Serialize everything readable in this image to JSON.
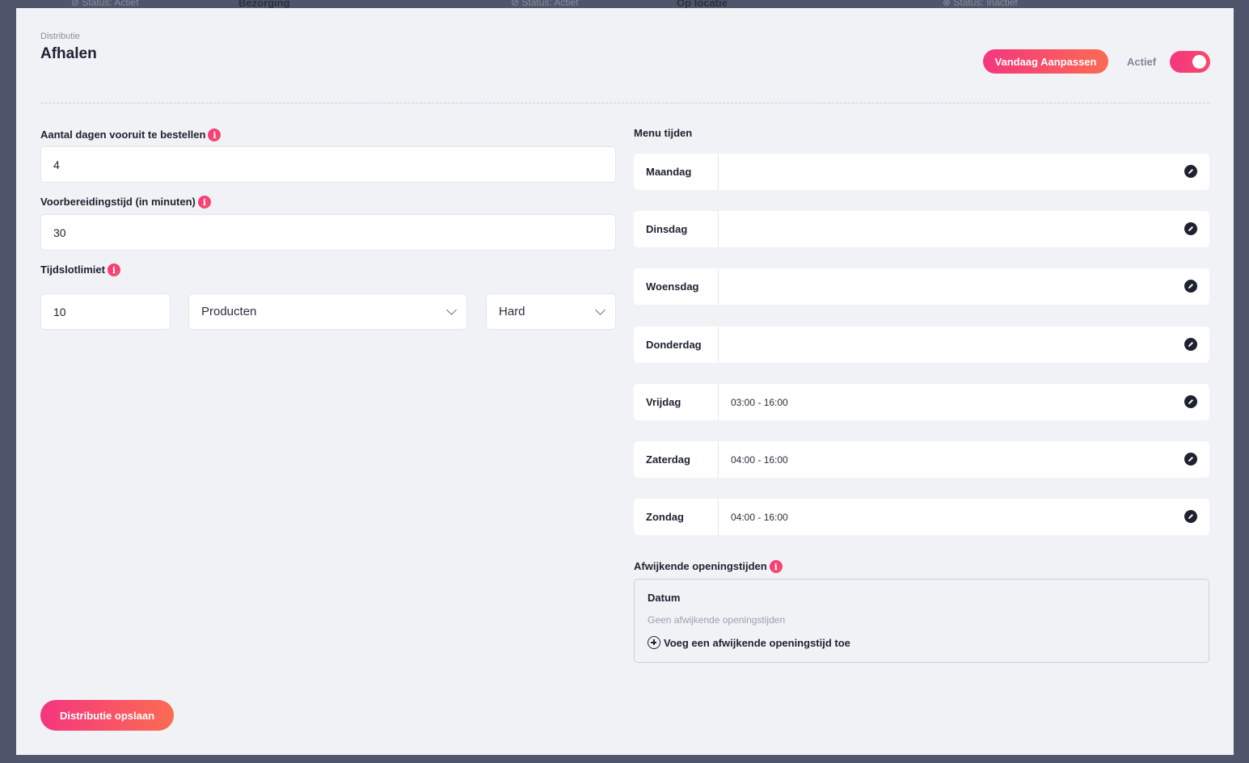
{
  "background_strip": {
    "items": [
      {
        "text": "⊘ Status: Actief"
      },
      {
        "text": "Bezorging",
        "bold": true
      },
      {
        "text": "⊘ Status: Actief"
      },
      {
        "text": "Op locatie",
        "bold": true
      },
      {
        "text": "⊗ Status: Inactief"
      }
    ]
  },
  "header": {
    "breadcrumb": "Distributie",
    "title": "Afhalen",
    "today_button": "Vandaag Aanpassen",
    "active_label": "Actief",
    "active_toggle": true
  },
  "form": {
    "days_ahead": {
      "label": "Aantal dagen vooruit te bestellen",
      "value": "4"
    },
    "prep_time": {
      "label": "Voorbereidingstijd (in minuten)",
      "value": "30"
    },
    "timeslot": {
      "label": "Tijdslotlimiet",
      "value": "10",
      "unit_selected": "Producten",
      "mode_selected": "Hard"
    }
  },
  "menu_times": {
    "title": "Menu tijden",
    "days": [
      {
        "name": "Maandag",
        "time": ""
      },
      {
        "name": "Dinsdag",
        "time": ""
      },
      {
        "name": "Woensdag",
        "time": ""
      },
      {
        "name": "Donderdag",
        "time": ""
      },
      {
        "name": "Vrijdag",
        "time": "03:00 - 16:00"
      },
      {
        "name": "Zaterdag",
        "time": "04:00 - 16:00"
      },
      {
        "name": "Zondag",
        "time": "04:00 - 16:00"
      }
    ]
  },
  "exceptions": {
    "title": "Afwijkende openingstijden",
    "column_header": "Datum",
    "empty_text": "Geen afwijkende openingstijden",
    "add_label": "Voeg een afwijkende openingstijd toe"
  },
  "footer": {
    "save_button": "Distributie opslaan"
  },
  "colors": {
    "accent_start": "#f5357f",
    "accent_end": "#fb6c52",
    "panel_bg": "#f1f2f6",
    "backdrop": "#4f566b"
  },
  "icons": {
    "info": "info-icon",
    "edit": "pencil-edit-icon",
    "add": "plus-circle-icon",
    "dropdown": "chevron-down-icon"
  }
}
